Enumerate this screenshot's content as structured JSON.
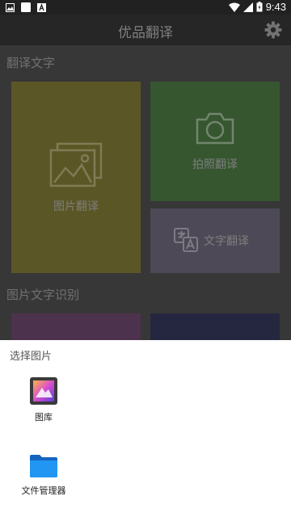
{
  "status_bar": {
    "time": "9:43",
    "left_icons": [
      "image-notification-icon",
      "blank-notification-icon",
      "a-notification-icon"
    ],
    "right_icons": [
      "wifi-icon",
      "signal-icon",
      "battery-icon"
    ]
  },
  "app_bar": {
    "title": "优品翻译",
    "settings_icon": "gear-icon"
  },
  "sections": {
    "translate_text": {
      "title": "翻译文字",
      "tiles": [
        {
          "label": "图片翻译",
          "icon": "image-gallery-icon",
          "color": "#6f6a2e"
        },
        {
          "label": "拍照翻译",
          "icon": "camera-icon",
          "color": "#426a3b"
        },
        {
          "label": "文字翻译",
          "icon": "translate-icon",
          "color": "#5e5a6a"
        }
      ]
    },
    "image_text_recognition": {
      "title": "图片文字识别",
      "tiles": [
        {
          "color": "#5e3e5f"
        },
        {
          "color": "#2e2f4d"
        }
      ]
    }
  },
  "sheet": {
    "title": "选择图片",
    "items": [
      {
        "label": "图库",
        "icon": "gallery-app-icon"
      },
      {
        "label": "文件管理器",
        "icon": "folder-icon"
      }
    ]
  }
}
